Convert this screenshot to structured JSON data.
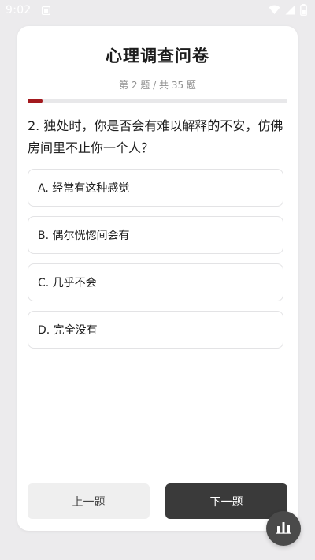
{
  "status_bar": {
    "time": "9:02",
    "icons": [
      "notification-icon",
      "wifi-icon",
      "signal-icon",
      "battery-icon"
    ]
  },
  "survey": {
    "title": "心理调查问卷",
    "counter": "第 2 题 / 共 35 题",
    "current": 2,
    "total": 35,
    "progress_fraction": 0.057,
    "question": "2. 独处时，你是否会有难以解释的不安，仿佛房间里不止你一个人？",
    "options": [
      "A. 经常有这种感觉",
      "B. 偶尔恍惚间会有",
      "C. 几乎不会",
      "D. 完全没有"
    ],
    "prev_label": "上一题",
    "next_label": "下一题"
  },
  "fab": {
    "icon": "bar-chart-icon"
  },
  "colors": {
    "background": "#ecebed",
    "card": "#ffffff",
    "progress_accent": "#a3191e",
    "next_button": "#3a3a3a",
    "prev_button": "#efefef"
  }
}
